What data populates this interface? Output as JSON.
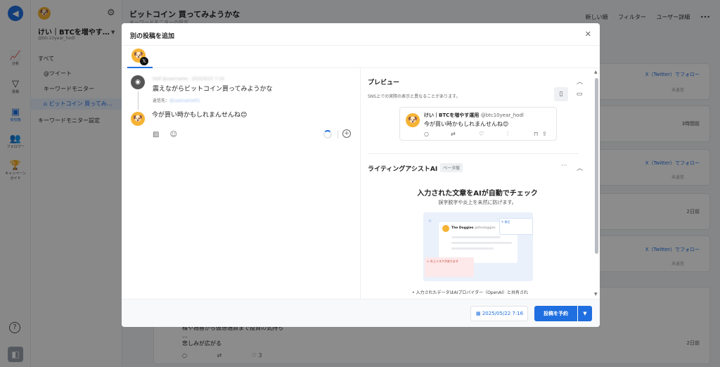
{
  "rail": {
    "items": [
      {
        "label": "分析",
        "icon": "chart-icon"
      },
      {
        "label": "投稿",
        "icon": "send-icon"
      },
      {
        "label": "受信箱",
        "icon": "inbox-icon"
      },
      {
        "label": "フォロワー",
        "icon": "users-icon"
      },
      {
        "label": "キャンペーン\nガイド",
        "icon": "trophy-icon"
      }
    ]
  },
  "sidebar": {
    "account_name": "けい｜BTCを増やす…",
    "account_handle": "@btc10year_hodl",
    "nav": [
      {
        "label": "すべて"
      },
      {
        "label": "@ツイート"
      },
      {
        "label": "キーワードモニター"
      },
      {
        "label": "ビットコイン 買ってみ…"
      },
      {
        "label": "キーワードモニター設定"
      }
    ]
  },
  "main": {
    "title": "ビットコイン 買ってみようかな",
    "subtitle": "キーワードモニターの設定",
    "toolbar": {
      "sort": "新しい順",
      "filter": "フィルター",
      "user_detail": "ユーザー詳細"
    },
    "follow_label": "X（Twitter）でフォロー",
    "unread_label": "未返信",
    "times": [
      "3時間前",
      "2日前",
      "2日前"
    ],
    "bottom_post": {
      "line1": "株や為替から仮想通貨まで投資の気持ち",
      "line2": "…",
      "line3": "悲しみが広がる",
      "likes": "3",
      "time": "2日前"
    }
  },
  "modal": {
    "title": "別の投稿を追加",
    "reply": {
      "name": "Dolf @username · 2025/5/22 7:16",
      "text": "震えながらビットコイン買ってみようかな",
      "reply_to_label": "返信先：",
      "reply_to_handle": "@username01"
    },
    "draft_text": "今が買い時かもしれまんせんね😊",
    "preview": {
      "heading": "プレビュー",
      "note": "SNS上での実際の表示と異なることがあります。",
      "tweet_name": "けい｜BTCを増やす運用",
      "tweet_handle": "@btc10year_hodl",
      "tweet_text": "今が買い時かもしれまんせんね😊"
    },
    "ai": {
      "heading": "ライティングアシストAI",
      "beta": "ベータ版",
      "title": "入力された文章をAIが自動でチェック",
      "subtitle": "誤字脱字や炎上を未然に防げます。",
      "illus_name": "The Doggies",
      "illus_handle": "@thedoggies",
      "illus_fix": "修正",
      "illus_risk": "炎上リスクがあります",
      "bullet": "入力されたデータはAIプロバイダー（OpenAI）と共有され"
    },
    "footer": {
      "date": "2025/05/22 7:16",
      "schedule": "投稿を予約"
    }
  },
  "colors": {
    "accent": "#1f6fe0",
    "overlay": "rgba(0,0,0,0.45)"
  }
}
